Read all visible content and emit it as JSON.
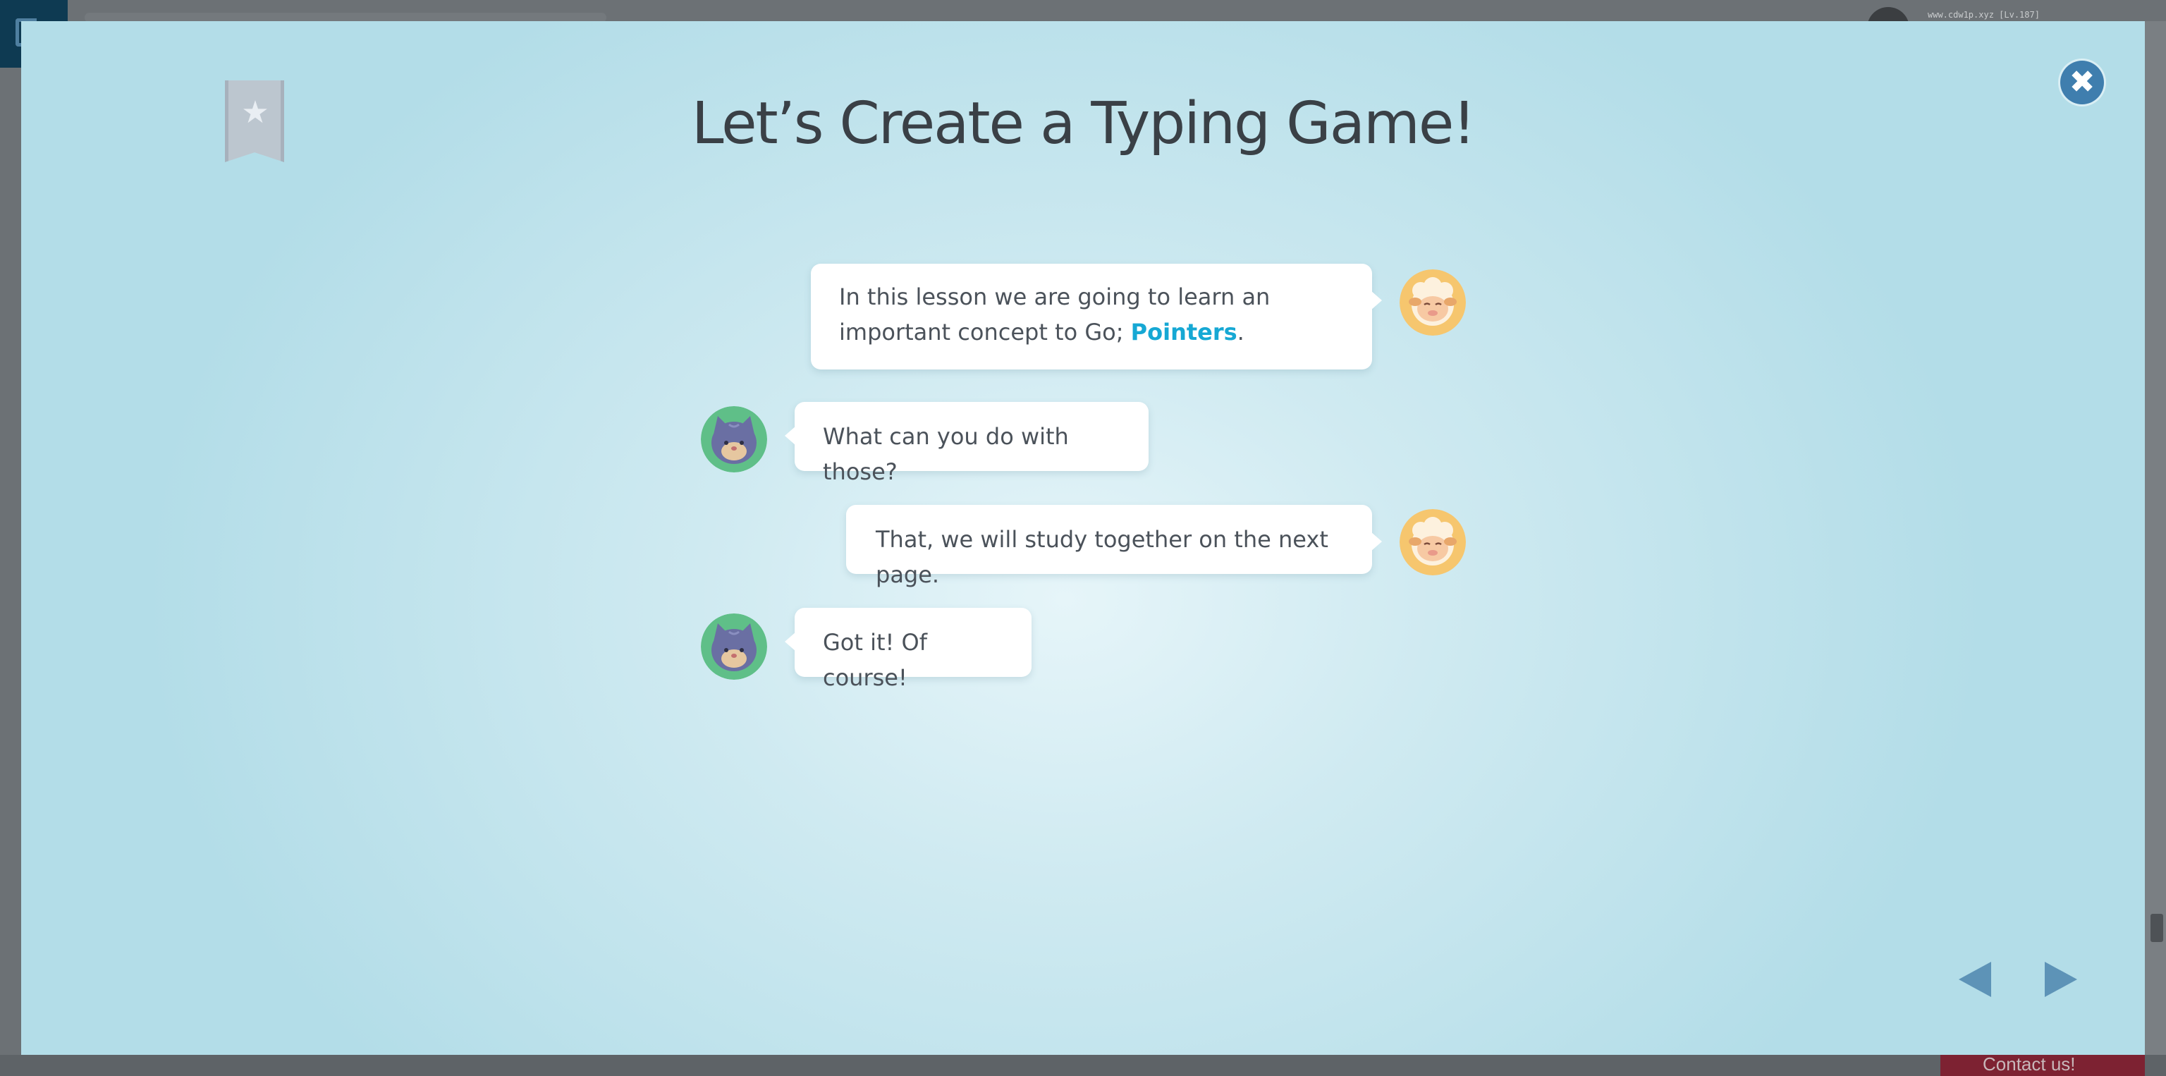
{
  "background": {
    "username": "www.cdw1p.xyz [Lv.187]",
    "contact_label": "Contact us!"
  },
  "lesson": {
    "title": "Let’s Create a Typing Game!",
    "close_label": "✖",
    "bookmark_icon": "bookmark-star-icon"
  },
  "dialogue": [
    {
      "speaker": "sheep",
      "side": "right",
      "text_before": "In this lesson we are going to learn an important concept to Go; ",
      "highlight": "Pointers",
      "text_after": "."
    },
    {
      "speaker": "cat",
      "side": "left",
      "text": "What can you do with those?"
    },
    {
      "speaker": "sheep",
      "side": "right",
      "text": "That, we will study together on the next page."
    },
    {
      "speaker": "cat",
      "side": "left",
      "text": "Got it! Of course!"
    }
  ],
  "navigation": {
    "prev_icon": "triangle-left-icon",
    "next_icon": "triangle-right-icon"
  },
  "colors": {
    "highlight": "#16a8d4",
    "close_button": "#3f7eae",
    "nav_arrow": "#5d93b7",
    "title": "#3a4046"
  }
}
